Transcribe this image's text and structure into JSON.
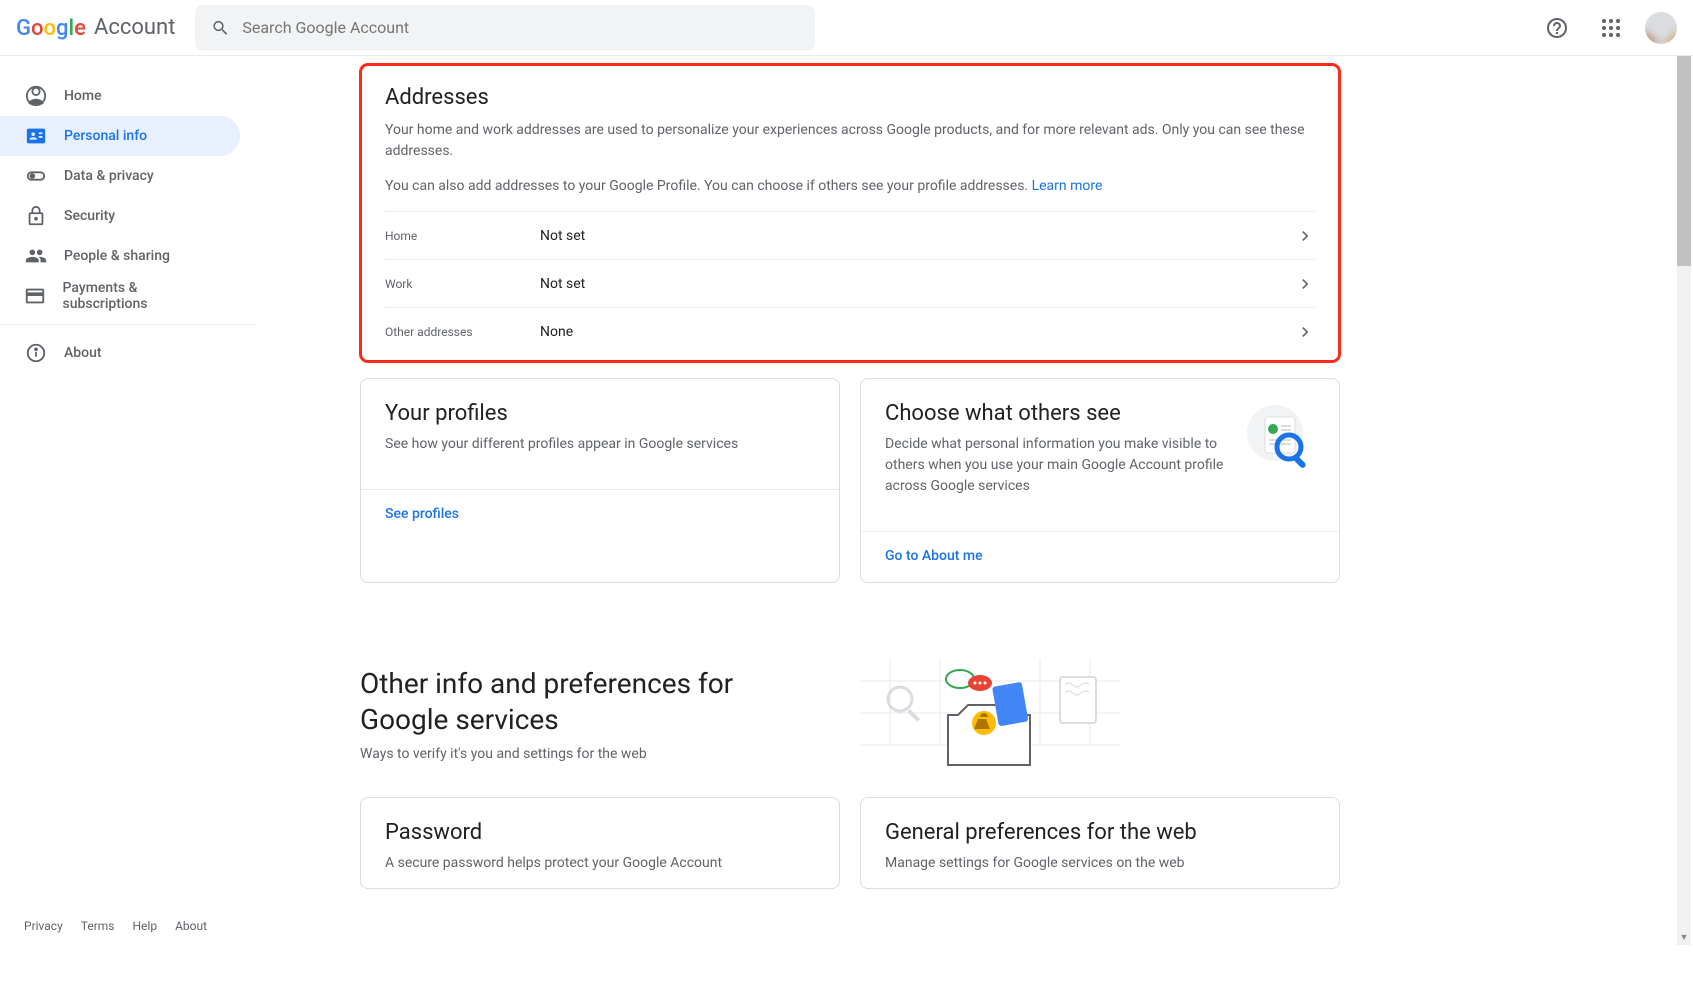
{
  "header": {
    "product": "Account",
    "search_placeholder": "Search Google Account"
  },
  "sidebar": {
    "items": [
      {
        "label": "Home"
      },
      {
        "label": "Personal info"
      },
      {
        "label": "Data & privacy"
      },
      {
        "label": "Security"
      },
      {
        "label": "People & sharing"
      },
      {
        "label": "Payments & subscriptions"
      }
    ],
    "about": "About",
    "footer": [
      "Privacy",
      "Terms",
      "Help",
      "About"
    ]
  },
  "addresses": {
    "title": "Addresses",
    "desc1": "Your home and work addresses are used to personalize your experiences across Google products, and for more relevant ads. Only you can see these addresses.",
    "desc2": "You can also add addresses to your Google Profile. You can choose if others see your profile addresses. ",
    "learn_more": "Learn more",
    "rows": [
      {
        "label": "Home",
        "value": "Not set"
      },
      {
        "label": "Work",
        "value": "Not set"
      },
      {
        "label": "Other addresses",
        "value": "None"
      }
    ]
  },
  "profiles_card": {
    "title": "Your profiles",
    "desc": "See how your different profiles appear in Google services",
    "link": "See profiles"
  },
  "others_card": {
    "title": "Choose what others see",
    "desc": "Decide what personal information you make visible to others when you use your main Google Account profile across Google services",
    "link": "Go to About me"
  },
  "other_info": {
    "title": "Other info and preferences for Google services",
    "sub": "Ways to verify it's you and settings for the web"
  },
  "password_card": {
    "title": "Password",
    "desc": "A secure password helps protect your Google Account"
  },
  "prefs_card": {
    "title": "General preferences for the web",
    "desc": "Manage settings for Google services on the web"
  }
}
